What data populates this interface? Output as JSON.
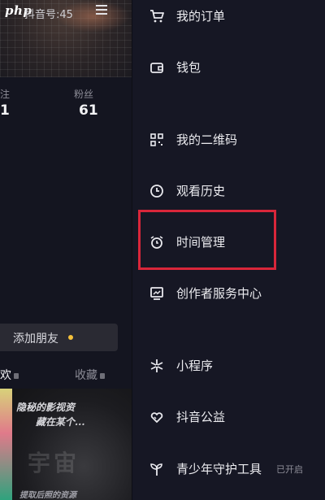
{
  "left": {
    "watermark": "php",
    "handle": "抖音号:45",
    "stats": [
      {
        "label": "注",
        "value": "1"
      },
      {
        "label": "粉丝",
        "value": "61"
      }
    ],
    "add_friend": "添加朋友",
    "tabs": {
      "likes": "欢",
      "favorites": "收藏"
    },
    "thumbnail_lines": [
      "隐秘的影视资",
      "藏在某个...",
      "提取后照的资源"
    ]
  },
  "drawer": {
    "items": [
      {
        "label": "我的订单",
        "icon": "cart-icon"
      },
      {
        "label": "钱包",
        "icon": "wallet-icon"
      },
      {
        "label": "我的二维码",
        "icon": "qr-code-icon"
      },
      {
        "label": "观看历史",
        "icon": "clock-icon"
      },
      {
        "label": "时间管理",
        "icon": "alarm-clock-icon"
      },
      {
        "label": "创作者服务中心",
        "icon": "monitor-chart-icon"
      },
      {
        "label": "小程序",
        "icon": "asterisk-icon"
      },
      {
        "label": "抖音公益",
        "icon": "heart-hands-icon"
      },
      {
        "label": "青少年守护工具",
        "icon": "sprout-icon",
        "status": "已开启"
      }
    ]
  },
  "colors": {
    "highlight": "#d9263a",
    "background": "#161724",
    "badge": "#f5c13b"
  }
}
